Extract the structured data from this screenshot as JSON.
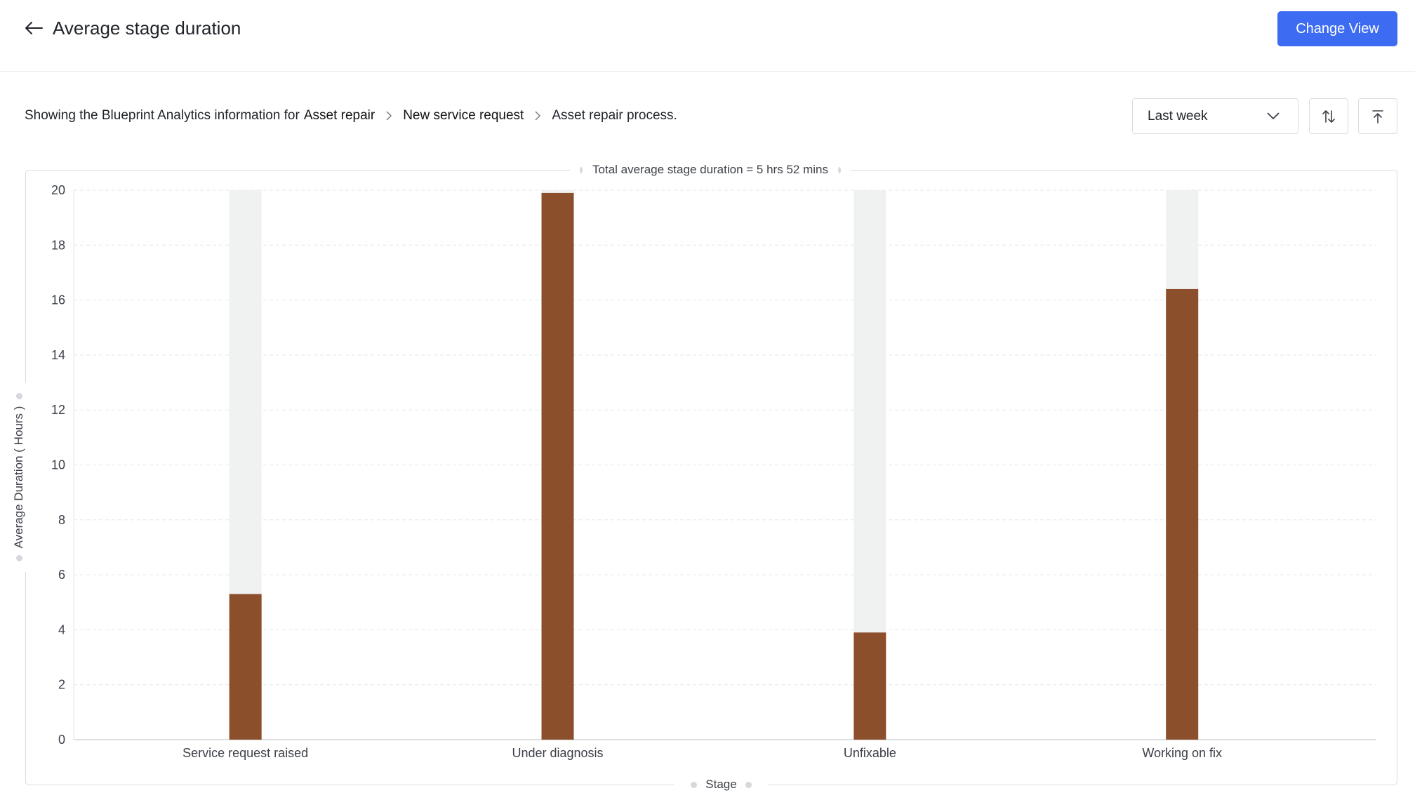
{
  "header": {
    "title": "Average stage duration",
    "change_view_label": "Change View",
    "back_icon": "arrow-left-icon"
  },
  "breadcrumb": {
    "prefix": "Showing the Blueprint Analytics information for",
    "items": [
      "Asset repair",
      "New service request",
      "Asset repair process."
    ]
  },
  "filters": {
    "period": "Last week",
    "sort_icon": "sort-arrows-icon",
    "export_icon": "upload-icon"
  },
  "colors": {
    "accent": "#3d6cf2",
    "bar": "#8b4f2c",
    "bar_track": "#f0f1f1",
    "grid": "#e4e6e8"
  },
  "chart_data": {
    "type": "bar",
    "title": "Total average stage duration = 5 hrs 52 mins",
    "xlabel": "Stage",
    "ylabel": "Average Duration ( Hours )",
    "categories": [
      "Service request raised",
      "Under diagnosis",
      "Unfixable",
      "Working on fix"
    ],
    "values": [
      5.3,
      19.9,
      3.9,
      16.4
    ],
    "ylim": [
      0,
      20
    ],
    "yticks": [
      0,
      2,
      4,
      6,
      8,
      10,
      12,
      14,
      16,
      18,
      20
    ],
    "grid": true,
    "legend": "none"
  }
}
